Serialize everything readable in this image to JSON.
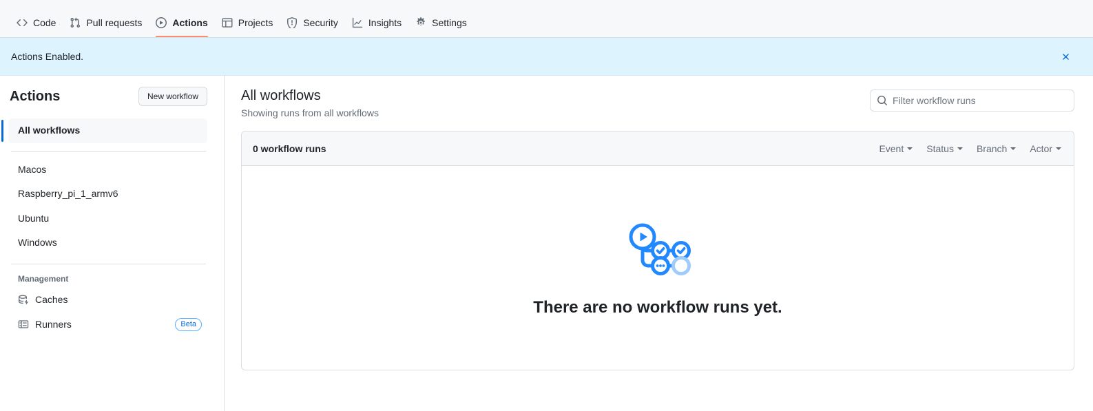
{
  "repo_nav": {
    "items": [
      {
        "label": "Code",
        "icon": "code-icon",
        "selected": false
      },
      {
        "label": "Pull requests",
        "icon": "git-pull-request-icon",
        "selected": false
      },
      {
        "label": "Actions",
        "icon": "play-circle-icon",
        "selected": true
      },
      {
        "label": "Projects",
        "icon": "table-icon",
        "selected": false
      },
      {
        "label": "Security",
        "icon": "shield-icon",
        "selected": false
      },
      {
        "label": "Insights",
        "icon": "graph-icon",
        "selected": false
      },
      {
        "label": "Settings",
        "icon": "gear-icon",
        "selected": false
      }
    ],
    "selected_underline_color": "#fd8c73"
  },
  "flash": {
    "message": "Actions Enabled.",
    "background_color": "#ddf4ff",
    "close_icon": "close-icon",
    "close_icon_color": "#0969da"
  },
  "sidebar": {
    "title": "Actions",
    "new_workflow_label": "New workflow",
    "active_item_accent": "#0969da",
    "items": [
      {
        "label": "All workflows",
        "active": true
      },
      {
        "label": "Macos",
        "active": false
      },
      {
        "label": "Raspberry_pi_1_armv6",
        "active": false
      },
      {
        "label": "Ubuntu",
        "active": false
      },
      {
        "label": "Windows",
        "active": false
      }
    ],
    "management": {
      "section_label": "Management",
      "items": [
        {
          "label": "Caches",
          "icon": "cache-database-icon",
          "badge": ""
        },
        {
          "label": "Runners",
          "icon": "server-icon",
          "badge": "Beta"
        }
      ]
    }
  },
  "main": {
    "title": "All workflows",
    "subtitle": "Showing runs from all workflows",
    "filter": {
      "placeholder": "Filter workflow runs",
      "value": "",
      "icon": "search-icon"
    },
    "runs_panel": {
      "count_label": "0 workflow runs",
      "filters": [
        {
          "label": "Event"
        },
        {
          "label": "Status"
        },
        {
          "label": "Branch"
        },
        {
          "label": "Actor"
        }
      ],
      "empty_state": {
        "illustration": "workflow-graph-illustration",
        "title": "There are no workflow runs yet.",
        "accent_color": "#2188ff",
        "muted_accent_color": "#9fccfa"
      }
    }
  }
}
